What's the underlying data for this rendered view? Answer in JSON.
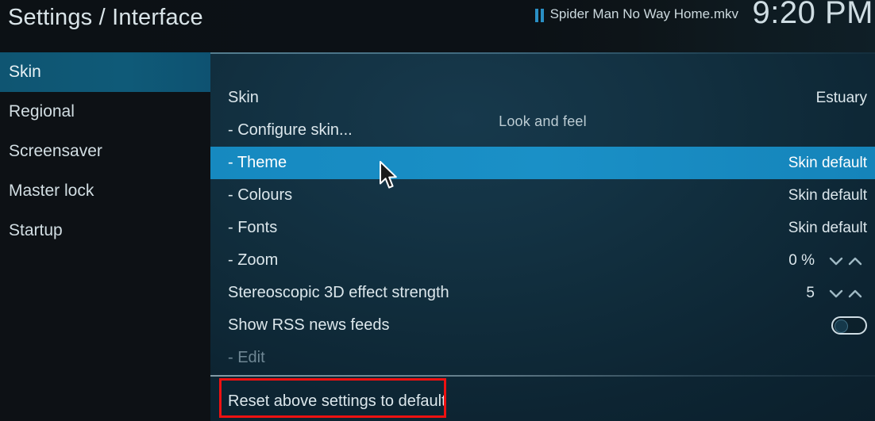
{
  "window": {
    "title": "Settings / Interface"
  },
  "topbar": {
    "now_playing": {
      "icon": "pause-icon",
      "label": "Spider Man No Way Home.mkv"
    },
    "clock": "9:20 PM"
  },
  "sidebar": {
    "items": [
      {
        "label": "Skin",
        "selected": true
      },
      {
        "label": "Regional",
        "selected": false
      },
      {
        "label": "Screensaver",
        "selected": false
      },
      {
        "label": "Master lock",
        "selected": false
      },
      {
        "label": "Startup",
        "selected": false
      }
    ]
  },
  "content": {
    "section_header": "Look and feel",
    "rows": [
      {
        "label": "Skin",
        "value": "Estuary",
        "control": "value",
        "state": "normal"
      },
      {
        "label": "- Configure skin...",
        "value": "",
        "control": "none",
        "state": "normal"
      },
      {
        "label": "- Theme",
        "value": "Skin default",
        "control": "value",
        "state": "highlighted"
      },
      {
        "label": "- Colours",
        "value": "Skin default",
        "control": "value",
        "state": "normal"
      },
      {
        "label": "- Fonts",
        "value": "Skin default",
        "control": "value",
        "state": "normal"
      },
      {
        "label": "- Zoom",
        "value": "0 %",
        "control": "spinner",
        "state": "normal"
      },
      {
        "label": "Stereoscopic 3D effect strength",
        "value": "5",
        "control": "spinner",
        "state": "normal"
      },
      {
        "label": "Show RSS news feeds",
        "value": "",
        "control": "toggle",
        "toggle_on": false,
        "state": "normal"
      },
      {
        "label": "- Edit",
        "value": "",
        "control": "none",
        "state": "disabled"
      }
    ],
    "footer_button": "Reset above settings to default"
  },
  "colors": {
    "accent_highlight": "#1a90c7",
    "sidebar_selected": "#0f5a78",
    "annotation_red": "#ee1111",
    "pause_icon_blue": "#2a8fc4",
    "text_primary": "#dce7ec",
    "text_disabled": "#6f8794"
  }
}
